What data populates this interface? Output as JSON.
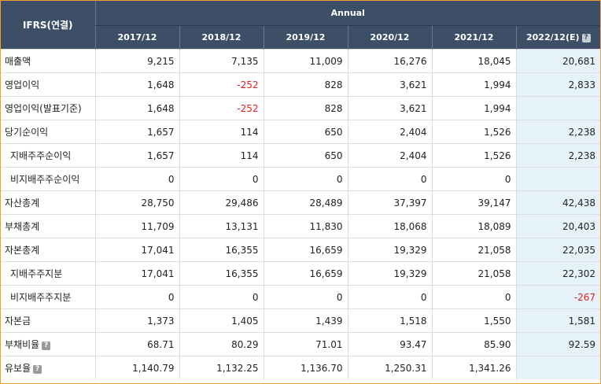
{
  "header": {
    "corner": "IFRS(연결)",
    "group": "Annual",
    "years": [
      "2017/12",
      "2018/12",
      "2019/12",
      "2020/12",
      "2021/12",
      "2022/12(E)"
    ]
  },
  "rows": [
    {
      "label": "매출액",
      "sub": false,
      "help": false,
      "values": [
        "9,215",
        "7,135",
        "11,009",
        "16,276",
        "18,045",
        "20,681"
      ]
    },
    {
      "label": "영업이익",
      "sub": false,
      "help": false,
      "values": [
        "1,648",
        "-252",
        "828",
        "3,621",
        "1,994",
        "2,833"
      ]
    },
    {
      "label": "영업이익(발표기준)",
      "sub": false,
      "help": false,
      "values": [
        "1,648",
        "-252",
        "828",
        "3,621",
        "1,994",
        ""
      ]
    },
    {
      "label": "당기순이익",
      "sub": false,
      "help": false,
      "values": [
        "1,657",
        "114",
        "650",
        "2,404",
        "1,526",
        "2,238"
      ]
    },
    {
      "label": "지배주주순이익",
      "sub": true,
      "help": false,
      "values": [
        "1,657",
        "114",
        "650",
        "2,404",
        "1,526",
        "2,238"
      ]
    },
    {
      "label": "비지배주주순이익",
      "sub": true,
      "help": false,
      "values": [
        "0",
        "0",
        "0",
        "0",
        "0",
        ""
      ]
    },
    {
      "label": "자산총계",
      "sub": false,
      "help": false,
      "values": [
        "28,750",
        "29,486",
        "28,489",
        "37,397",
        "39,147",
        "42,438"
      ]
    },
    {
      "label": "부채총계",
      "sub": false,
      "help": false,
      "values": [
        "11,709",
        "13,131",
        "11,830",
        "18,068",
        "18,089",
        "20,403"
      ]
    },
    {
      "label": "자본총계",
      "sub": false,
      "help": false,
      "values": [
        "17,041",
        "16,355",
        "16,659",
        "19,329",
        "21,058",
        "22,035"
      ]
    },
    {
      "label": "지배주주지분",
      "sub": true,
      "help": false,
      "values": [
        "17,041",
        "16,355",
        "16,659",
        "19,329",
        "21,058",
        "22,302"
      ]
    },
    {
      "label": "비지배주주지분",
      "sub": true,
      "help": false,
      "values": [
        "0",
        "0",
        "0",
        "0",
        "0",
        "-267"
      ]
    },
    {
      "label": "자본금",
      "sub": false,
      "help": false,
      "values": [
        "1,373",
        "1,405",
        "1,439",
        "1,518",
        "1,550",
        "1,581"
      ]
    },
    {
      "label": "부채비율",
      "sub": false,
      "help": true,
      "values": [
        "68.71",
        "80.29",
        "71.01",
        "93.47",
        "85.90",
        "92.59"
      ]
    },
    {
      "label": "유보율",
      "sub": false,
      "help": true,
      "values": [
        "1,140.79",
        "1,132.25",
        "1,136.70",
        "1,250.31",
        "1,341.26",
        ""
      ]
    }
  ],
  "help_glyph": "?",
  "colors": {
    "header_bg": "#3d4f66",
    "estimate_bg": "#e6f2fa",
    "negative": "#e02020",
    "frame_border": "#f0a030"
  }
}
